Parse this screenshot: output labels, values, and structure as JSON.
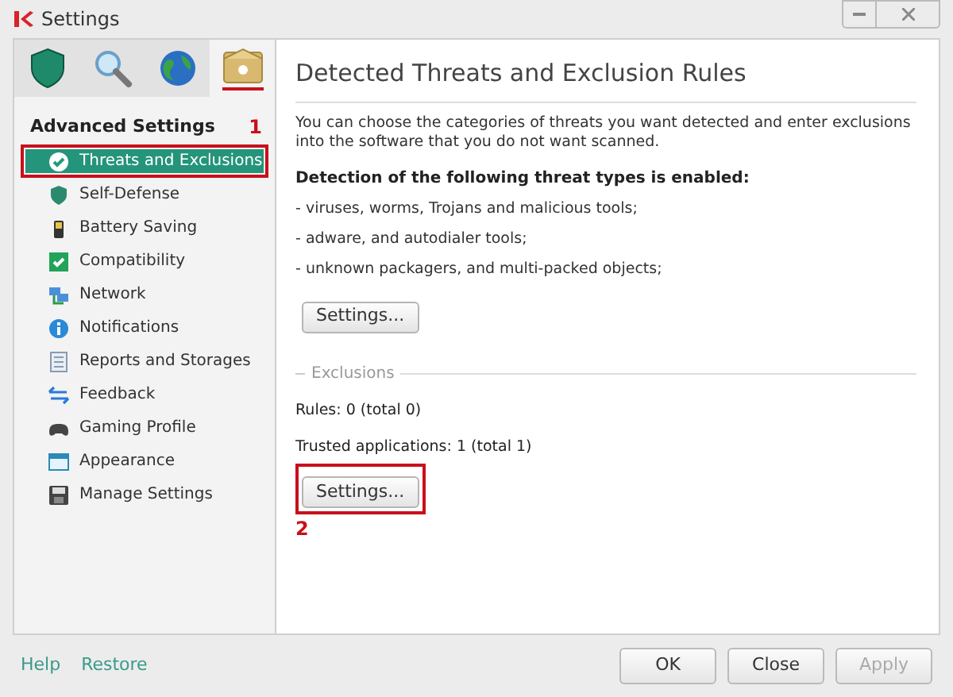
{
  "window": {
    "title": "Settings"
  },
  "tabs": [
    {
      "selected": false
    },
    {
      "selected": false
    },
    {
      "selected": false
    },
    {
      "selected": true
    }
  ],
  "sidebar": {
    "heading": "Advanced Settings",
    "marker": "1",
    "items": [
      {
        "label": "Threats and Exclusions",
        "selected": true,
        "highlighted": true
      },
      {
        "label": "Self-Defense",
        "selected": false,
        "highlighted": false
      },
      {
        "label": "Battery Saving",
        "selected": false,
        "highlighted": false
      },
      {
        "label": "Compatibility",
        "selected": false,
        "highlighted": false
      },
      {
        "label": "Network",
        "selected": false,
        "highlighted": false
      },
      {
        "label": "Notifications",
        "selected": false,
        "highlighted": false
      },
      {
        "label": "Reports and Storages",
        "selected": false,
        "highlighted": false
      },
      {
        "label": "Feedback",
        "selected": false,
        "highlighted": false
      },
      {
        "label": "Gaming Profile",
        "selected": false,
        "highlighted": false
      },
      {
        "label": "Appearance",
        "selected": false,
        "highlighted": false
      },
      {
        "label": "Manage Settings",
        "selected": false,
        "highlighted": false
      }
    ]
  },
  "content": {
    "title": "Detected Threats and Exclusion Rules",
    "description": "You can choose the categories of threats you want detected and enter exclusions into the software that you do not want scanned.",
    "detection_heading": "Detection of the following threat types is enabled:",
    "threat_types": [
      "- viruses, worms, Trojans and malicious tools;",
      "- adware, and autodialer tools;",
      "- unknown packagers, and multi-packed objects;"
    ],
    "detection_button": {
      "label": "Settings...",
      "highlighted": false
    },
    "exclusions": {
      "legend": "Exclusions",
      "rules": "Rules: 0 (total 0)",
      "trusted": "Trusted applications: 1 (total 1)",
      "button": {
        "label": "Settings...",
        "highlighted": true
      },
      "marker": "2"
    }
  },
  "footer": {
    "links": [
      "Help",
      "Restore"
    ],
    "buttons": [
      {
        "label": "OK",
        "disabled": false
      },
      {
        "label": "Close",
        "disabled": false
      },
      {
        "label": "Apply",
        "disabled": true
      }
    ]
  }
}
